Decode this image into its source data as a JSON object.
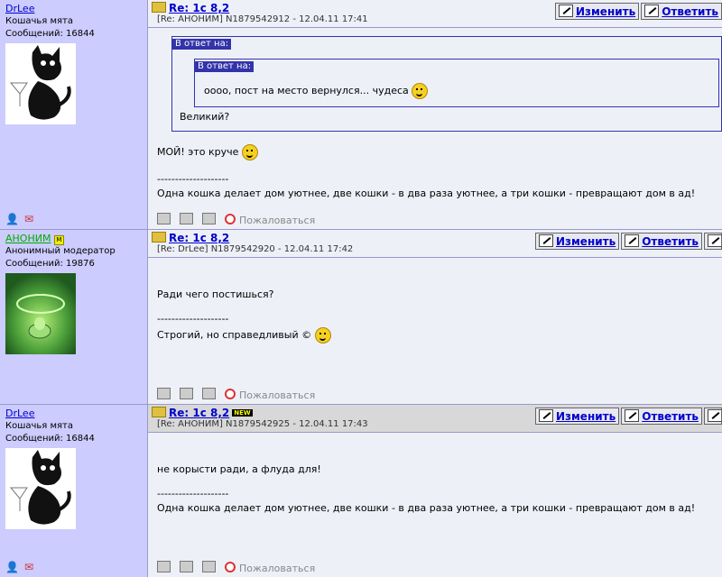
{
  "posts": [
    {
      "author": "DrLee",
      "rank": "Кошачья мята",
      "messages_label": "Сообщений: 16844",
      "subject": "Re: 1c 8,2",
      "ref": "[Re: АНОНИМ]  N1879542912 - 12.04.11 17:41",
      "edit_label": "Изменить",
      "reply_label": "Ответить",
      "quote_outer_header": "В ответ на:",
      "quote_inner_header": "В ответ на:",
      "quote_inner_text": "оооо, пост на место вернулся... чудеса",
      "quote_outer_text": "Великий?",
      "text": "МОЙ! это круче",
      "separator": "--------------------",
      "signature": "Одна кошка делает дом уютнее, две кошки - в два раза уютнее, а три кошки - превращают дом в ад!",
      "complain_label": "Пожаловаться"
    },
    {
      "author": "АНОНИМ",
      "rank": "Анонимный модератор",
      "messages_label": "Сообщений: 19876",
      "subject": "Re: 1c 8,2",
      "ref": "[Re: DrLee]  N1879542920 - 12.04.11 17:42",
      "edit_label": "Изменить",
      "reply_label": "Ответить",
      "text": "Ради чего постишься?",
      "separator": "--------------------",
      "signature": "Строгий, но справедливый ©",
      "complain_label": "Пожаловаться"
    },
    {
      "author": "DrLee",
      "rank": "Кошачья мята",
      "messages_label": "Сообщений: 16844",
      "subject": "Re: 1c 8,2",
      "new_badge": "NEW",
      "ref": "[Re: АНОНИМ]  N1879542925 - 12.04.11 17:43",
      "edit_label": "Изменить",
      "reply_label": "Ответить",
      "text": "не корысти ради, а флуда для!",
      "separator": "--------------------",
      "signature": "Одна кошка делает дом уютнее, две кошки - в два раза уютнее, а три кошки - превращают дом в ад!",
      "complain_label": "Пожаловаться"
    }
  ],
  "colors": {
    "author_bg": "#ccccff",
    "link": "#0000cc",
    "moderator": "#00aa00",
    "quote_header": "#3333aa"
  }
}
